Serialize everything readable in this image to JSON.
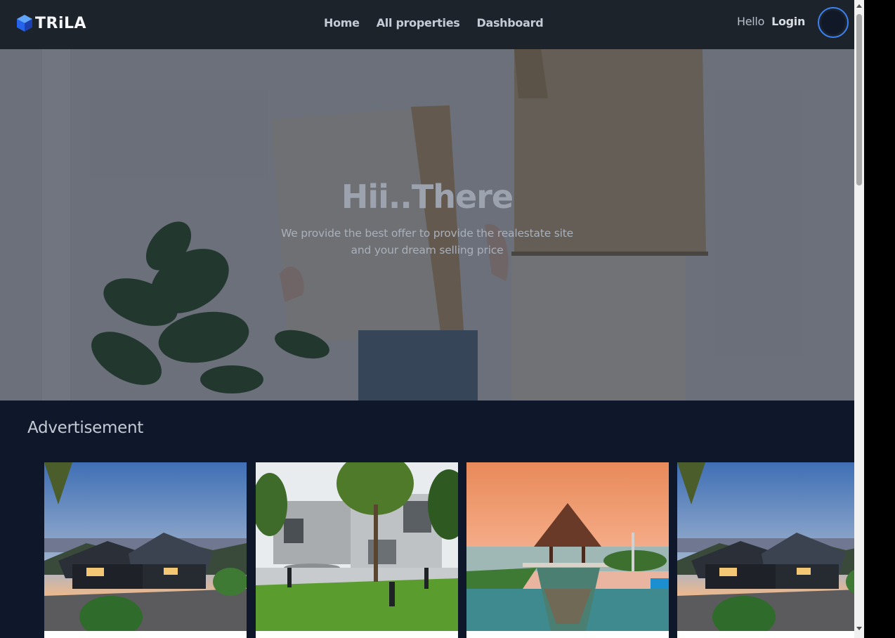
{
  "brand": {
    "name": "TRiLA",
    "logo_icon": "cube-icon"
  },
  "nav": {
    "links": [
      {
        "label": "Home"
      },
      {
        "label": "All properties"
      },
      {
        "label": "Dashboard"
      }
    ],
    "greeting": "Hello",
    "login_label": "Login"
  },
  "hero": {
    "title": "Hii..There",
    "subtitle": "We provide the best offer to provide the realestate site and your dream selling price"
  },
  "advertisement": {
    "heading": "Advertisement",
    "cards": [
      {
        "image": "house-dusk-photo"
      },
      {
        "image": "modern-concrete-house-photo"
      },
      {
        "image": "sunset-pool-gazebo-photo"
      },
      {
        "image": "house-dusk-photo"
      }
    ]
  },
  "colors": {
    "navbar_bg": "#1d232a",
    "page_bg": "#0f172a",
    "avatar_ring": "#3b82f6"
  }
}
